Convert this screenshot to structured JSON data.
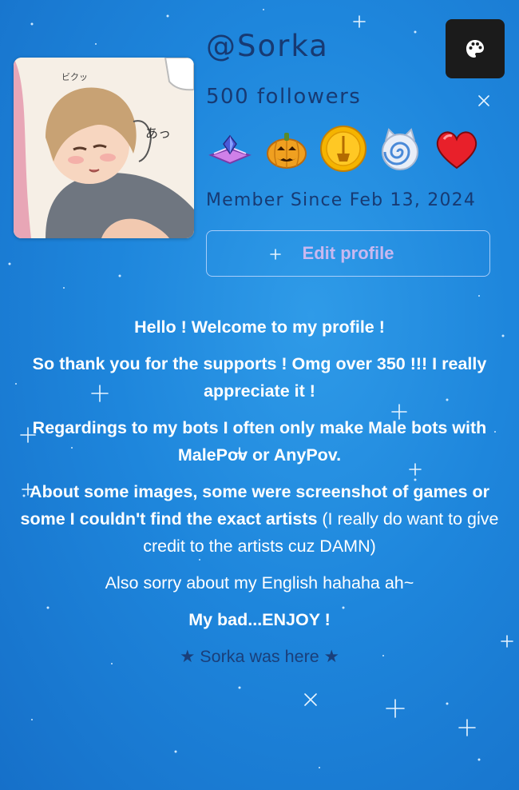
{
  "profile": {
    "username": "@Sorka",
    "followers": "500 followers",
    "member_since": "Member Since Feb 13, 2024",
    "edit_label": "Edit profile",
    "badges": [
      "gem-book-icon",
      "pumpkin-icon",
      "gold-coin-icon",
      "swirl-icon",
      "heart-icon"
    ],
    "theme_icon": "palette-icon"
  },
  "bio": {
    "line1": "Hello ! Welcome to my profile !",
    "line2": "So thank you for the supports ! Omg over 350 !!! I really appreciate it !",
    "line3": "Regardings to my bots I often only make Male bots with MalePov or AnyPov.",
    "line4_bold": "About some images, some were screenshot of games or some I couldn't find the exact artists",
    "line4_normal": " (I really do want to give credit to the artists cuz DAMN)",
    "line5": "Also sorry about my English hahaha ah~",
    "line6": "My bad...ENJOY !",
    "line7": "★ Sorka was here ★"
  },
  "colors": {
    "background": "#1e86dc",
    "text_dark": "#173a73",
    "edit_text": "#c8b8f0",
    "theme_button": "#1b1b1b"
  }
}
